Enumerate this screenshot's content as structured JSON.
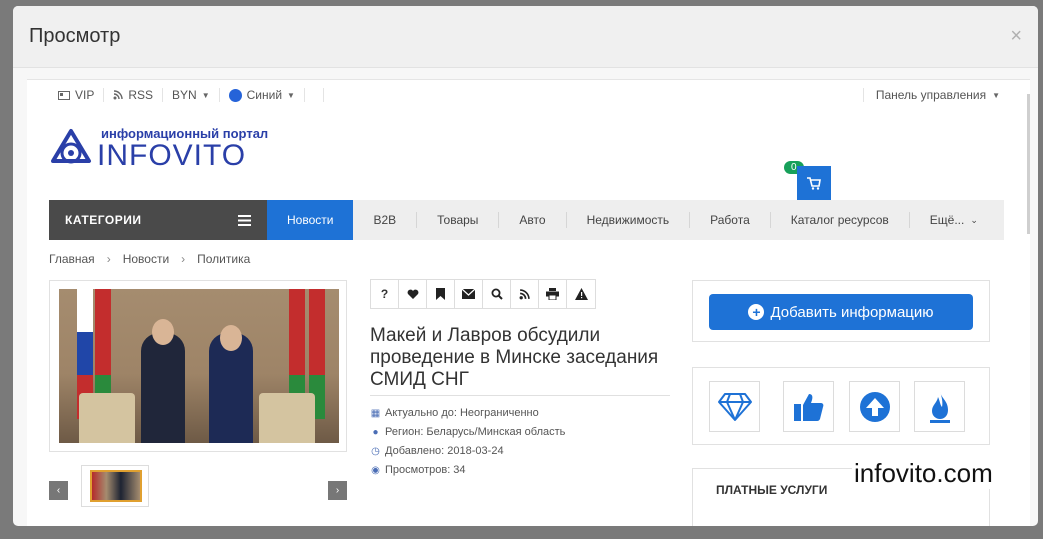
{
  "modal": {
    "title": "Просмотр",
    "close_symbol": "×"
  },
  "topbar": {
    "vip": "VIP",
    "rss": "RSS",
    "currency": "BYN",
    "theme": "Синий",
    "control_panel": "Панель управления"
  },
  "logo": {
    "tagline": "информационный портал",
    "name": "INFOVITO"
  },
  "cart": {
    "count": "0"
  },
  "nav": {
    "categories": "КАТЕГОРИИ",
    "active": "Новости",
    "items": [
      "B2B",
      "Товары",
      "Авто",
      "Недвижимость",
      "Работа",
      "Каталог ресурсов",
      "Ещё..."
    ]
  },
  "breadcrumbs": [
    "Главная",
    "Новости",
    "Политика"
  ],
  "article": {
    "headline": "Макей и Лавров обсудили проведение в Минске заседания СМИД СНГ",
    "tools": [
      "?",
      "heart",
      "bookmark",
      "envelope",
      "search",
      "rss",
      "print",
      "warning"
    ],
    "meta": {
      "actual_until": "Актуально до: Неограниченно",
      "region": "Регион: Беларусь/Минская область",
      "added": "Добавлено: 2018-03-24",
      "views": "Просмотров: 34"
    }
  },
  "sidebar": {
    "add_button": "Добавить информацию",
    "service_icons": [
      "diamond",
      "thumbs-up",
      "arrow-up-circle",
      "flame"
    ],
    "paid_services": "ПЛАТНЫЕ УСЛУГИ"
  },
  "watermark": "infovito.com",
  "colors": {
    "primary": "#1e72d6",
    "dark": "#4a4a4a",
    "badge": "#17a05a"
  }
}
